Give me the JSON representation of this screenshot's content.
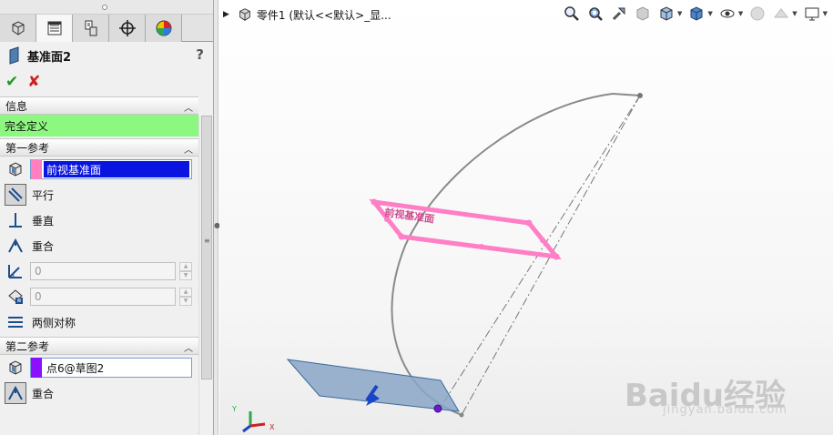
{
  "property_manager": {
    "title": "基准面2",
    "help": "?",
    "ok": "✔",
    "cancel": "✘",
    "sections": {
      "info": {
        "label": "信息",
        "status": "完全定义"
      },
      "first_ref": {
        "label": "第一参考",
        "value": "前视基准面",
        "swatch_color": "#ff7fbf",
        "options": {
          "parallel": "平行",
          "perpendicular": "垂直",
          "coincident": "重合",
          "symmetric": "两侧对称"
        },
        "angle_value": "0",
        "distance_value": "0"
      },
      "second_ref": {
        "label": "第二参考",
        "value": "点6@草图2",
        "swatch_color": "#8a10ff",
        "option_coincident": "重合"
      }
    }
  },
  "viewport": {
    "breadcrumb": "零件1  (默认<<默认>_显...",
    "toolbar_icons": [
      "zoom-to-fit-icon",
      "zoom-to-area-icon",
      "previous-view-icon",
      "section-view-icon",
      "view-orientation-icon",
      "display-style-icon",
      "hide-show-icon",
      "edit-appearance-icon",
      "apply-scene-icon",
      "view-settings-icon"
    ],
    "axis": {
      "x": "X",
      "y": "Y"
    },
    "plane_label": "前视基准面",
    "colors": {
      "preview_plane": "#ff7fc6",
      "reference_plane": "#8aa6c6",
      "point": "#6a1cc9",
      "sketch": "#888888"
    }
  },
  "watermark": {
    "brand": "Baidu经验",
    "url": "jingyan.baidu.com"
  }
}
